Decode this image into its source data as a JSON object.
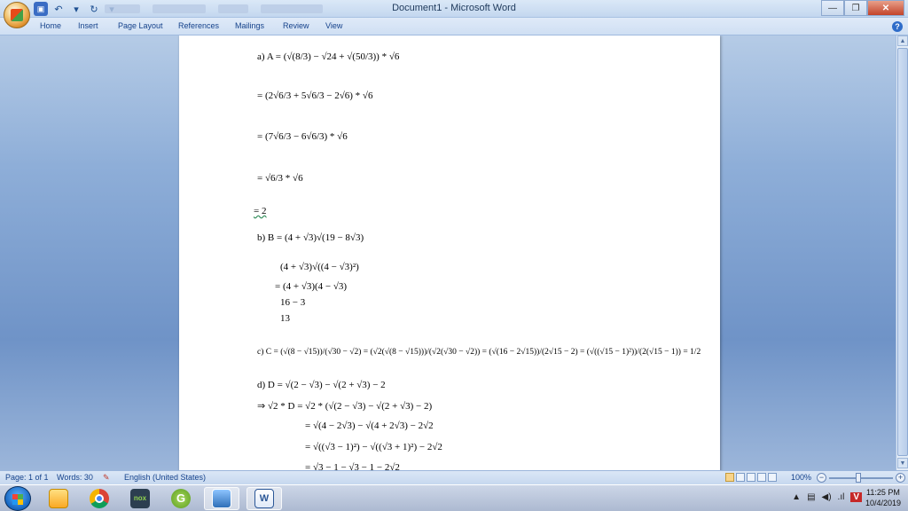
{
  "window": {
    "title": "Document1 - Microsoft Word"
  },
  "ribbon": {
    "tabs": [
      "Home",
      "Insert",
      "Page Layout",
      "References",
      "Mailings",
      "Review",
      "View"
    ]
  },
  "document": {
    "lines": [
      "a)  A = (√(8/3) − √24 + √(50/3)) * √6",
      "= (2√6/3 + 5√6/3 − 2√6) * √6",
      "= (7√6/3 − 6√6/3) * √6",
      "= √6/3 * √6",
      "= 2",
      "b)  B = (4 + √3)√(19 − 8√3)",
      "(4 + √3)√((4 − √3)²)",
      "= (4 + √3)(4 − √3)",
      "16 − 3",
      "13",
      "c)  C = (√(8 − √15))/(√30 − √2) = (√2(√(8 − √15)))/(√2(√30 − √2)) = (√(16 − 2√15))/(2√15 − 2) = (√((√15 − 1)²))/(2(√15 − 1)) = 1/2",
      "d)  D = √(2 − √3) − √(2 + √3) − 2",
      "⇒  √2 * D = √2 * (√(2 − √3) − √(2 + √3) − 2)",
      "= √(4 − 2√3) − √(4 + 2√3) − 2√2",
      "= √((√3 − 1)²) − √((√3 + 1)²) − 2√2",
      "= √3 − 1 − √3 − 1 − 2√2"
    ]
  },
  "statusbar": {
    "page": "Page: 1 of 1",
    "words": "Words: 30",
    "language": "English (United States)",
    "zoom": "100%"
  },
  "taskbar": {
    "time": "11:25 PM",
    "date": "10/4/2019"
  },
  "icons": {
    "office": "office-button-icon",
    "save": "save-icon",
    "undo": "undo-icon",
    "redo": "redo-icon"
  }
}
